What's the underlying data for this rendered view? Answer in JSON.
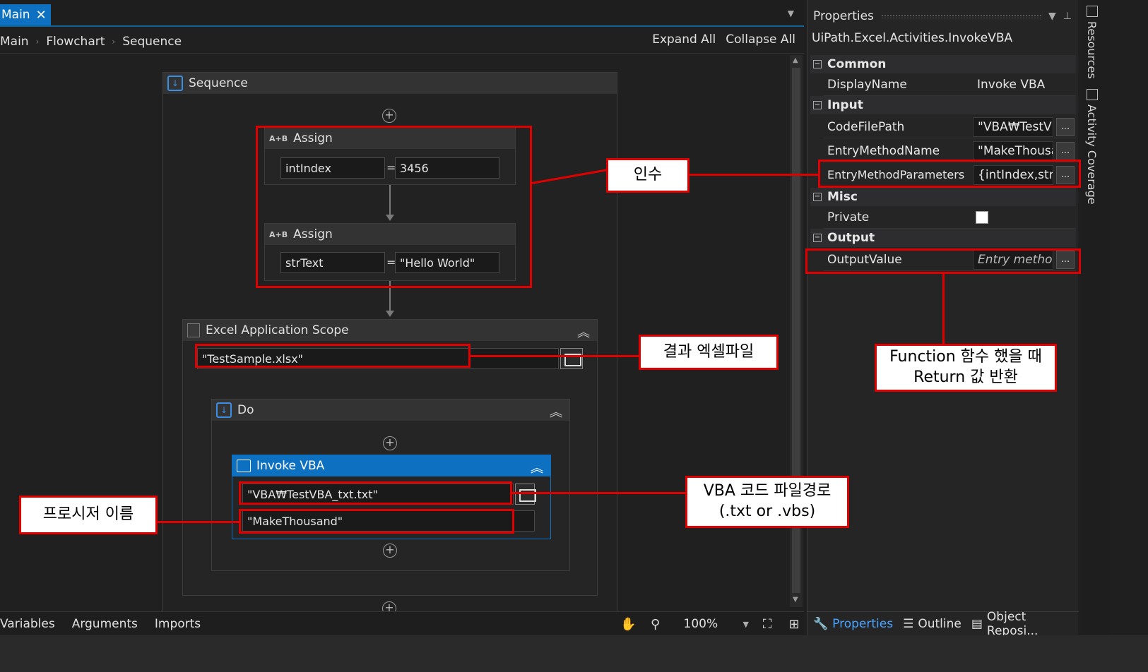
{
  "tabs": {
    "main_label": "Main",
    "close_glyph": "✕"
  },
  "breadcrumb": {
    "items": [
      "Main",
      "Flowchart",
      "Sequence"
    ],
    "separator": "›"
  },
  "toolbar": {
    "expand_all": "Expand All",
    "collapse_all": "Collapse All"
  },
  "sequence": {
    "title": "Sequence"
  },
  "assign1": {
    "title": "Assign",
    "icon_text": "A+B",
    "to": "intIndex",
    "value": "3456"
  },
  "assign2": {
    "title": "Assign",
    "icon_text": "A+B",
    "to": "strText",
    "value": "\"Hello World\""
  },
  "excel_scope": {
    "title": "Excel Application Scope",
    "path": "\"TestSample.xlsx\""
  },
  "do_block": {
    "title": "Do"
  },
  "invoke_vba": {
    "title": "Invoke VBA",
    "code_path": "\"VBA₩TestVBA_txt.txt\"",
    "method": "\"MakeThousand\""
  },
  "annotations": {
    "args": "인수",
    "result_file": "결과 엑셀파일",
    "function_return_line1": "Function 함수 했을 때",
    "function_return_line2": "Return 값 반환",
    "vba_path_line1": "VBA 코드 파일경로",
    "vba_path_line2": "(.txt or .vbs)",
    "procedure_name": "프로시저 이름"
  },
  "bottom_bar": {
    "variables": "Variables",
    "arguments": "Arguments",
    "imports": "Imports",
    "zoom": "100%",
    "hand_icon": "hand-icon",
    "search_icon": "magnifier-icon"
  },
  "properties": {
    "title": "Properties",
    "type_name": "UiPath.Excel.Activities.InvokeVBA",
    "categories": {
      "common": "Common",
      "input": "Input",
      "misc": "Misc",
      "output": "Output"
    },
    "rows": {
      "display_name": {
        "name": "DisplayName",
        "value": "Invoke VBA"
      },
      "code_file_path": {
        "name": "CodeFilePath",
        "value": "\"VBA₩TestVB"
      },
      "entry_method_name": {
        "name": "EntryMethodName",
        "value": "\"MakeThousa"
      },
      "entry_method_parameters": {
        "name": "EntryMethodParameters",
        "value": "{intIndex,strTe"
      },
      "private": {
        "name": "Private",
        "checked": false
      },
      "output_value": {
        "name": "OutputValue",
        "value": "Entry methoc"
      }
    },
    "ellipsis": "...",
    "bottom_tabs": {
      "properties": "Properties",
      "outline": "Outline",
      "object_repo": "Object Reposi..."
    }
  },
  "side_tabs": {
    "resources": "Resources",
    "activity_coverage": "Activity Coverage"
  },
  "colors": {
    "accent": "#0e70c0",
    "annotation": "#e00000",
    "background": "#202020"
  }
}
